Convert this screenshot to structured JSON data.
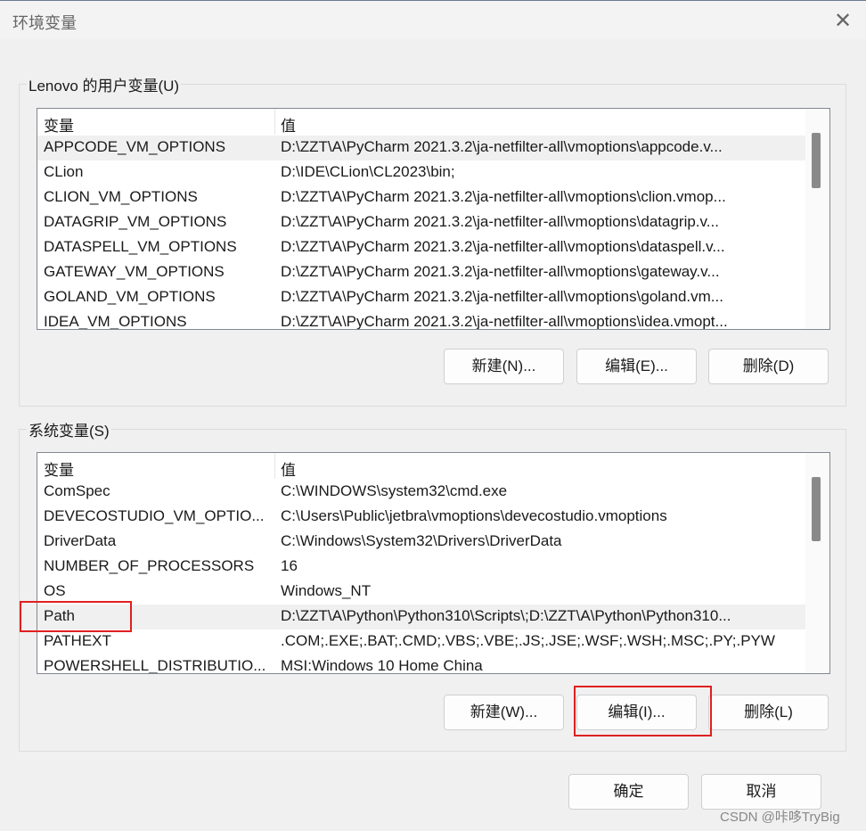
{
  "window": {
    "title": "环境变量",
    "close_icon": "close-icon"
  },
  "user_vars": {
    "legend": "Lenovo 的用户变量(U)",
    "col_name": "变量",
    "col_value": "值",
    "rows": [
      {
        "name": "APPCODE_VM_OPTIONS",
        "value": "D:\\ZZT\\A\\PyCharm 2021.3.2\\ja-netfilter-all\\vmoptions\\appcode.v..."
      },
      {
        "name": "CLion",
        "value": "D:\\IDE\\CLion\\CL2023\\bin;"
      },
      {
        "name": "CLION_VM_OPTIONS",
        "value": "D:\\ZZT\\A\\PyCharm 2021.3.2\\ja-netfilter-all\\vmoptions\\clion.vmop..."
      },
      {
        "name": "DATAGRIP_VM_OPTIONS",
        "value": "D:\\ZZT\\A\\PyCharm 2021.3.2\\ja-netfilter-all\\vmoptions\\datagrip.v..."
      },
      {
        "name": "DATASPELL_VM_OPTIONS",
        "value": "D:\\ZZT\\A\\PyCharm 2021.3.2\\ja-netfilter-all\\vmoptions\\dataspell.v..."
      },
      {
        "name": "GATEWAY_VM_OPTIONS",
        "value": "D:\\ZZT\\A\\PyCharm 2021.3.2\\ja-netfilter-all\\vmoptions\\gateway.v..."
      },
      {
        "name": "GOLAND_VM_OPTIONS",
        "value": "D:\\ZZT\\A\\PyCharm 2021.3.2\\ja-netfilter-all\\vmoptions\\goland.vm..."
      },
      {
        "name": "IDEA_VM_OPTIONS",
        "value": "D:\\ZZT\\A\\PyCharm 2021.3.2\\ja-netfilter-all\\vmoptions\\idea.vmopt..."
      }
    ],
    "new": "新建(N)...",
    "edit": "编辑(E)...",
    "delete": "删除(D)"
  },
  "sys_vars": {
    "legend": "系统变量(S)",
    "col_name": "变量",
    "col_value": "值",
    "rows": [
      {
        "name": "ComSpec",
        "value": "C:\\WINDOWS\\system32\\cmd.exe"
      },
      {
        "name": "DEVECOSTUDIO_VM_OPTIO...",
        "value": "C:\\Users\\Public\\jetbra\\vmoptions\\devecostudio.vmoptions"
      },
      {
        "name": "DriverData",
        "value": "C:\\Windows\\System32\\Drivers\\DriverData"
      },
      {
        "name": "NUMBER_OF_PROCESSORS",
        "value": "16"
      },
      {
        "name": "OS",
        "value": "Windows_NT"
      },
      {
        "name": "Path",
        "value": "D:\\ZZT\\A\\Python\\Python310\\Scripts\\;D:\\ZZT\\A\\Python\\Python310..."
      },
      {
        "name": "PATHEXT",
        "value": ".COM;.EXE;.BAT;.CMD;.VBS;.VBE;.JS;.JSE;.WSF;.WSH;.MSC;.PY;.PYW"
      },
      {
        "name": "POWERSHELL_DISTRIBUTIO...",
        "value": "MSI:Windows 10 Home China"
      }
    ],
    "new": "新建(W)...",
    "edit": "编辑(I)...",
    "delete": "删除(L)"
  },
  "footer": {
    "ok": "确定",
    "cancel": "取消"
  },
  "watermark": "CSDN @咔哆TryBig",
  "colors": {
    "highlight": "#e02020",
    "selected_row": "#f0f0f0"
  }
}
